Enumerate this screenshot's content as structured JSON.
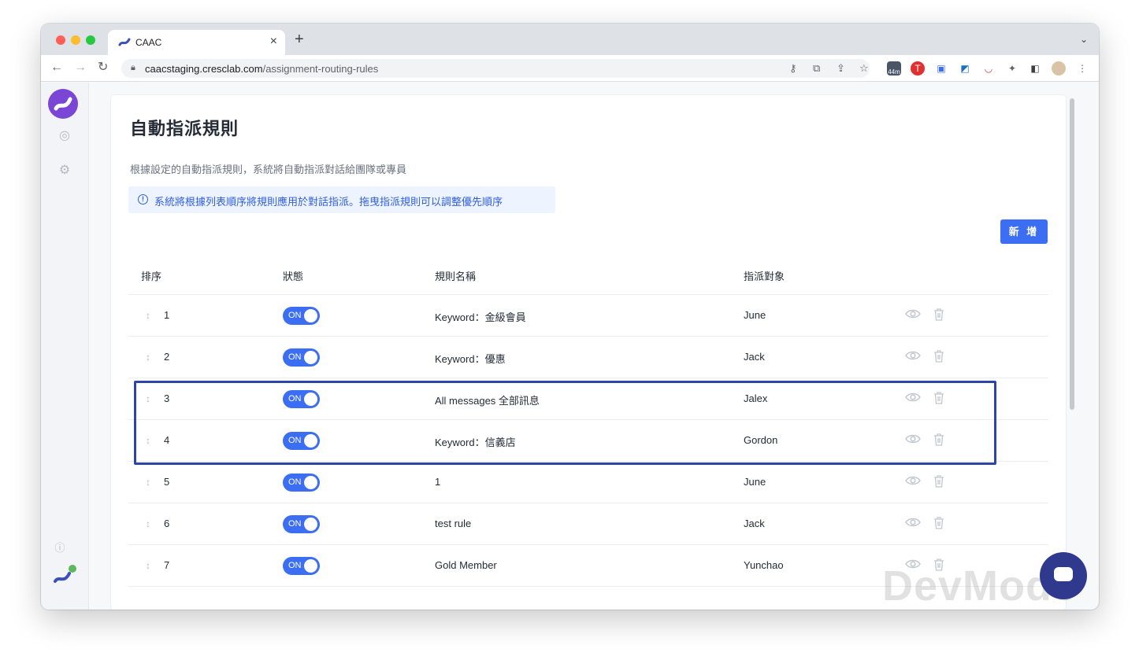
{
  "browser": {
    "tab_title": "CAAC",
    "url_domain": "caacstaging.cresclab.com",
    "url_path": "/assignment-routing-rules",
    "ext_badge": "44m"
  },
  "page": {
    "title": "自動指派規則",
    "description": "根據設定的自動指派規則，系統將自動指派對話給團隊或專員",
    "notice": "系統將根據列表順序將規則應用於對話指派。拖曳指派規則可以調整優先順序",
    "add_button": "新 增"
  },
  "table": {
    "headers": {
      "order": "排序",
      "status": "狀態",
      "rule_name": "規則名稱",
      "assignee": "指派對象"
    },
    "rows": [
      {
        "order": "1",
        "status": "ON",
        "name": "Keyword：金級會員",
        "assignee": "June"
      },
      {
        "order": "2",
        "status": "ON",
        "name": "Keyword：優惠",
        "assignee": "Jack"
      },
      {
        "order": "3",
        "status": "ON",
        "name": "All messages 全部訊息",
        "assignee": "Jalex"
      },
      {
        "order": "4",
        "status": "ON",
        "name": "Keyword：信義店",
        "assignee": "Gordon"
      },
      {
        "order": "5",
        "status": "ON",
        "name": "1",
        "assignee": "June"
      },
      {
        "order": "6",
        "status": "ON",
        "name": "test rule",
        "assignee": "Jack"
      },
      {
        "order": "7",
        "status": "ON",
        "name": "Gold Member",
        "assignee": "Yunchao"
      }
    ]
  },
  "watermark": "DevMode",
  "colors": {
    "accent": "#3b6ef2",
    "brand_purple": "#7b45d6",
    "highlight_border": "#2e44a8"
  }
}
